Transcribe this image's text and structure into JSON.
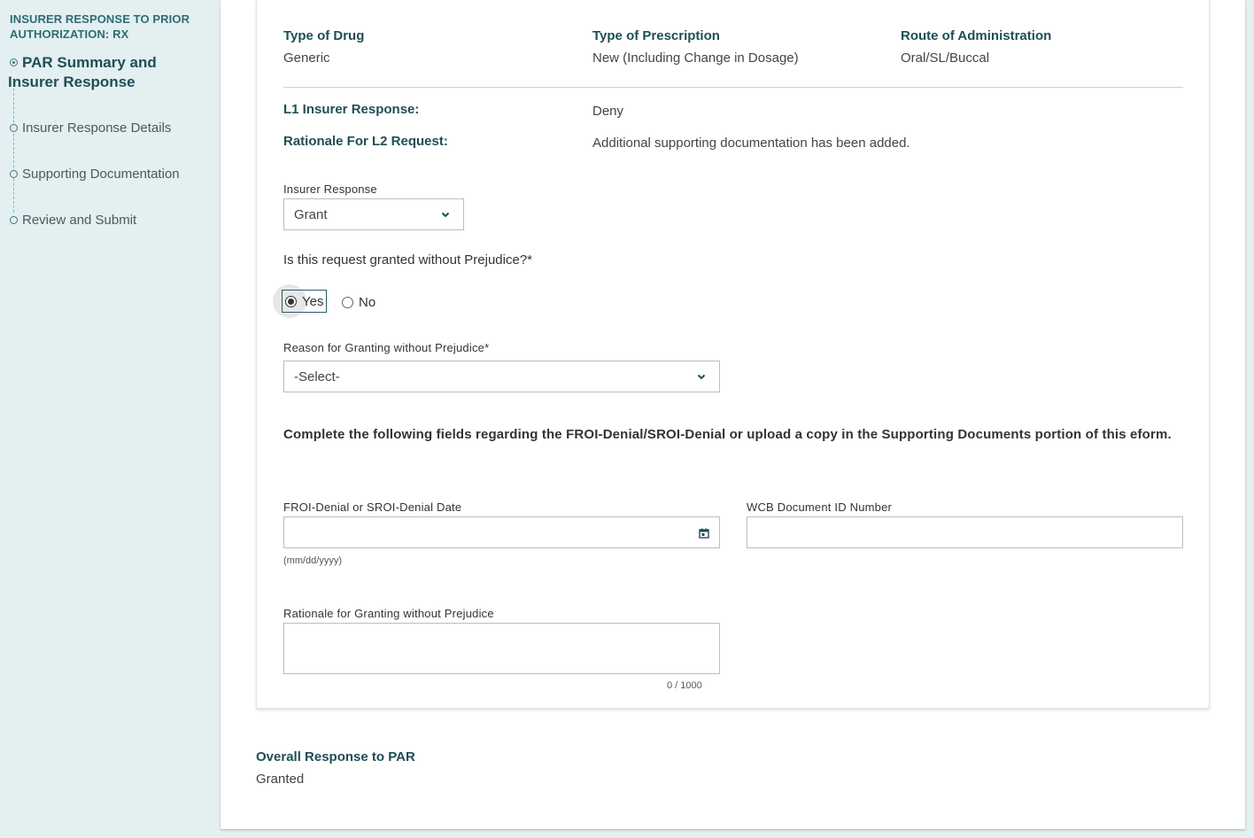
{
  "sidebar": {
    "title": "INSURER RESPONSE TO PRIOR AUTHORIZATION: RX",
    "items": [
      {
        "label": "PAR Summary and Insurer Response",
        "active": true
      },
      {
        "label": "Insurer Response Details",
        "active": false
      },
      {
        "label": "Supporting Documentation",
        "active": false
      },
      {
        "label": "Review and Submit",
        "active": false
      }
    ]
  },
  "summary": {
    "type_of_drug_label": "Type of Drug",
    "type_of_drug_value": "Generic",
    "type_of_prescription_label": "Type of Prescription",
    "type_of_prescription_value": "New (Including Change in Dosage)",
    "route_label": "Route of Administration",
    "route_value": "Oral/SL/Buccal",
    "l1_response_label": "L1 Insurer Response:",
    "l1_response_value": "Deny",
    "rationale_l2_label": "Rationale For L2 Request:",
    "rationale_l2_value": "Additional supporting documentation has been added."
  },
  "form": {
    "insurer_response_label": "Insurer Response",
    "insurer_response_value": "Grant",
    "prejudice_question": "Is this request granted without Prejudice?*",
    "radio_yes": "Yes",
    "radio_no": "No",
    "radio_selected": "Yes",
    "reason_label": "Reason for Granting without Prejudice*",
    "reason_value": "-Select-",
    "instructions": "Complete the following fields regarding the FROI-Denial/SROI-Denial or upload a copy in the Supporting Documents portion of this eform.",
    "denial_date_label": "FROI-Denial or SROI-Denial Date",
    "denial_date_value": "",
    "denial_date_hint": "(mm/dd/yyyy)",
    "wcb_doc_label": "WCB Document ID Number",
    "wcb_doc_value": "",
    "rationale_label": "Rationale for Granting without Prejudice",
    "rationale_value": "",
    "rationale_counter": "0 / 1000"
  },
  "overall": {
    "label": "Overall Response to PAR",
    "value": "Granted"
  },
  "colors": {
    "sidebar_bg": "#e3eff0",
    "heading_teal": "#1f4e56",
    "accent_teal": "#2f6b73"
  }
}
